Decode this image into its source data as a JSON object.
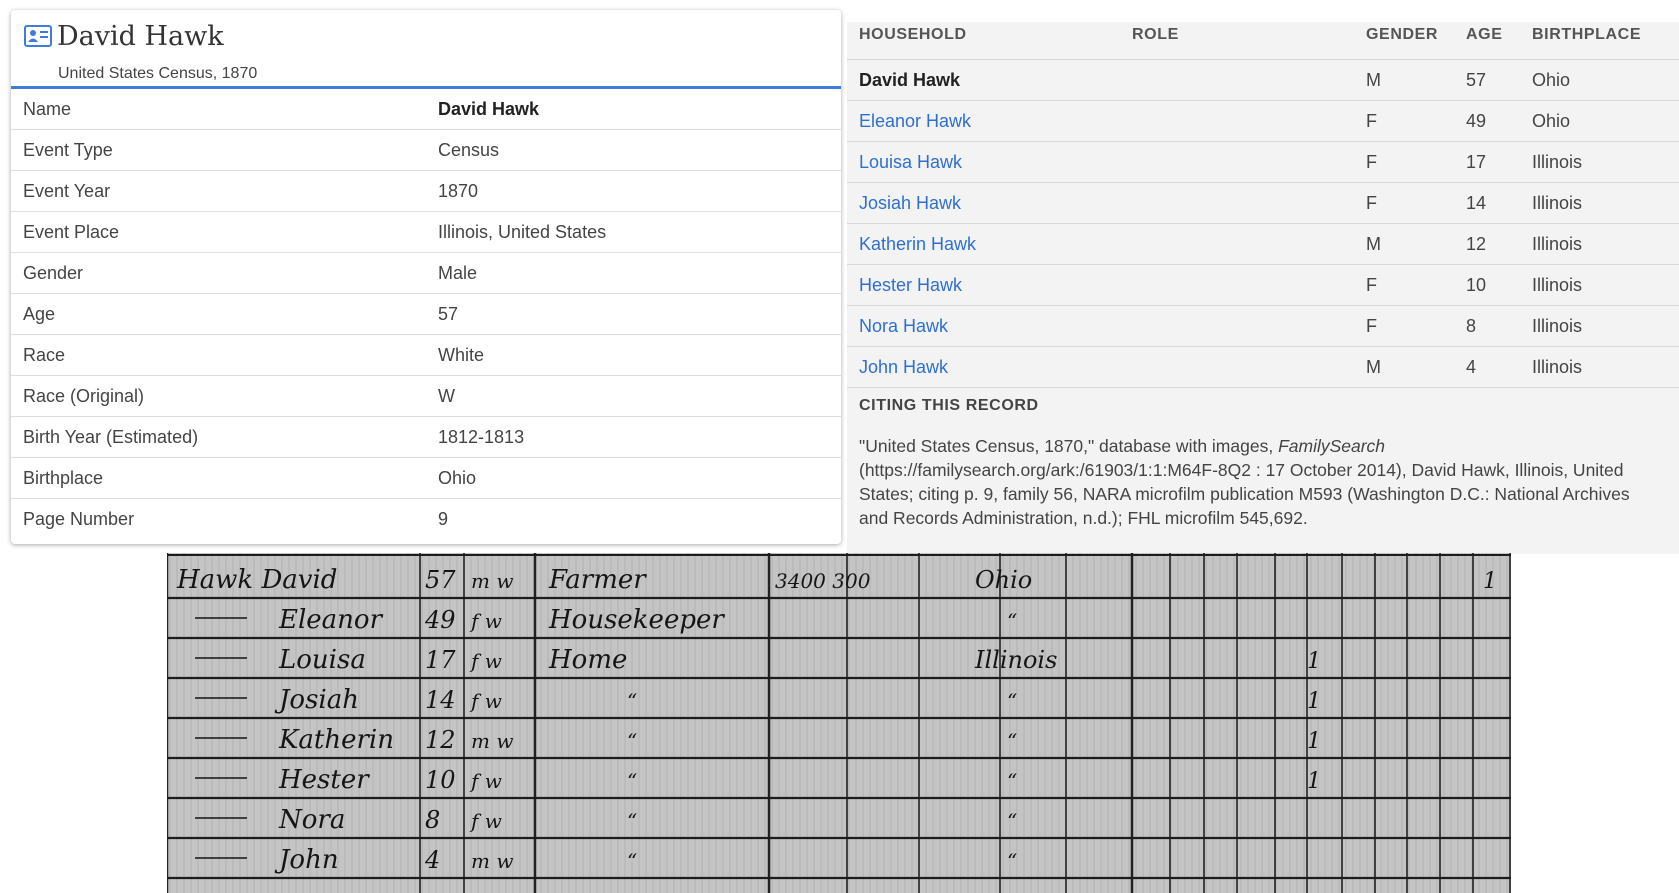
{
  "record": {
    "title": "David Hawk",
    "subtitle": "United States Census, 1870",
    "facts": [
      {
        "label": "Name",
        "value": "David Hawk"
      },
      {
        "label": "Event Type",
        "value": "Census"
      },
      {
        "label": "Event Year",
        "value": "1870"
      },
      {
        "label": "Event Place",
        "value": "Illinois, United States"
      },
      {
        "label": "Gender",
        "value": "Male"
      },
      {
        "label": "Age",
        "value": "57"
      },
      {
        "label": "Race",
        "value": "White"
      },
      {
        "label": "Race (Original)",
        "value": "W"
      },
      {
        "label": "Birth Year (Estimated)",
        "value": "1812-1813"
      },
      {
        "label": "Birthplace",
        "value": "Ohio"
      },
      {
        "label": "Page Number",
        "value": "9"
      }
    ]
  },
  "household": {
    "headers": {
      "household": "HOUSEHOLD",
      "role": "ROLE",
      "gender": "GENDER",
      "age": "AGE",
      "birthplace": "BIRTHPLACE"
    },
    "members": [
      {
        "name": "David Hawk",
        "role": "",
        "gender": "M",
        "age": "57",
        "birthplace": "Ohio"
      },
      {
        "name": "Eleanor Hawk",
        "role": "",
        "gender": "F",
        "age": "49",
        "birthplace": "Ohio"
      },
      {
        "name": "Louisa Hawk",
        "role": "",
        "gender": "F",
        "age": "17",
        "birthplace": "Illinois"
      },
      {
        "name": "Josiah Hawk",
        "role": "",
        "gender": "F",
        "age": "14",
        "birthplace": "Illinois"
      },
      {
        "name": "Katherin Hawk",
        "role": "",
        "gender": "M",
        "age": "12",
        "birthplace": "Illinois"
      },
      {
        "name": "Hester Hawk",
        "role": "",
        "gender": "F",
        "age": "10",
        "birthplace": "Illinois"
      },
      {
        "name": "Nora Hawk",
        "role": "",
        "gender": "F",
        "age": "8",
        "birthplace": "Illinois"
      },
      {
        "name": "John Hawk",
        "role": "",
        "gender": "M",
        "age": "4",
        "birthplace": "Illinois"
      }
    ]
  },
  "citation": {
    "heading": "CITING THIS RECORD",
    "text_before": "\"United States Census, 1870,\" database with images, ",
    "source_italic": "FamilySearch",
    "text_after": " (https://familysearch.org/ark:/61903/1:1:M64F-8Q2 : 17 October 2014), David Hawk, Illinois, United States; citing p. 9, family 56, NARA microfilm publication M593 (Washington D.C.: National Archives and Records Administration, n.d.); FHL microfilm 545,692."
  },
  "scan": {
    "rows": [
      {
        "name": "Hawk David",
        "age": "57",
        "sexrace": "m w",
        "occupation": "Farmer",
        "value": "3400 300",
        "birthplace": "Ohio",
        "mark": "1"
      },
      {
        "name": "Eleanor",
        "age": "49",
        "sexrace": "f w",
        "occupation": "Housekeeper",
        "value": "",
        "birthplace": "“",
        "mark": ""
      },
      {
        "name": "Louisa",
        "age": "17",
        "sexrace": "f w",
        "occupation": "Home",
        "value": "",
        "birthplace": "Illinois",
        "mark": "1"
      },
      {
        "name": "Josiah",
        "age": "14",
        "sexrace": "f w",
        "occupation": "“",
        "value": "",
        "birthplace": "“",
        "mark": "1"
      },
      {
        "name": "Katherin",
        "age": "12",
        "sexrace": "m w",
        "occupation": "“",
        "value": "",
        "birthplace": "“",
        "mark": "1"
      },
      {
        "name": "Hester",
        "age": "10",
        "sexrace": "f w",
        "occupation": "“",
        "value": "",
        "birthplace": "“",
        "mark": "1"
      },
      {
        "name": "Nora",
        "age": "8",
        "sexrace": "f w",
        "occupation": "“",
        "value": "",
        "birthplace": "“",
        "mark": ""
      },
      {
        "name": "John",
        "age": "4",
        "sexrace": "m w",
        "occupation": "“",
        "value": "",
        "birthplace": "“",
        "mark": ""
      }
    ]
  }
}
